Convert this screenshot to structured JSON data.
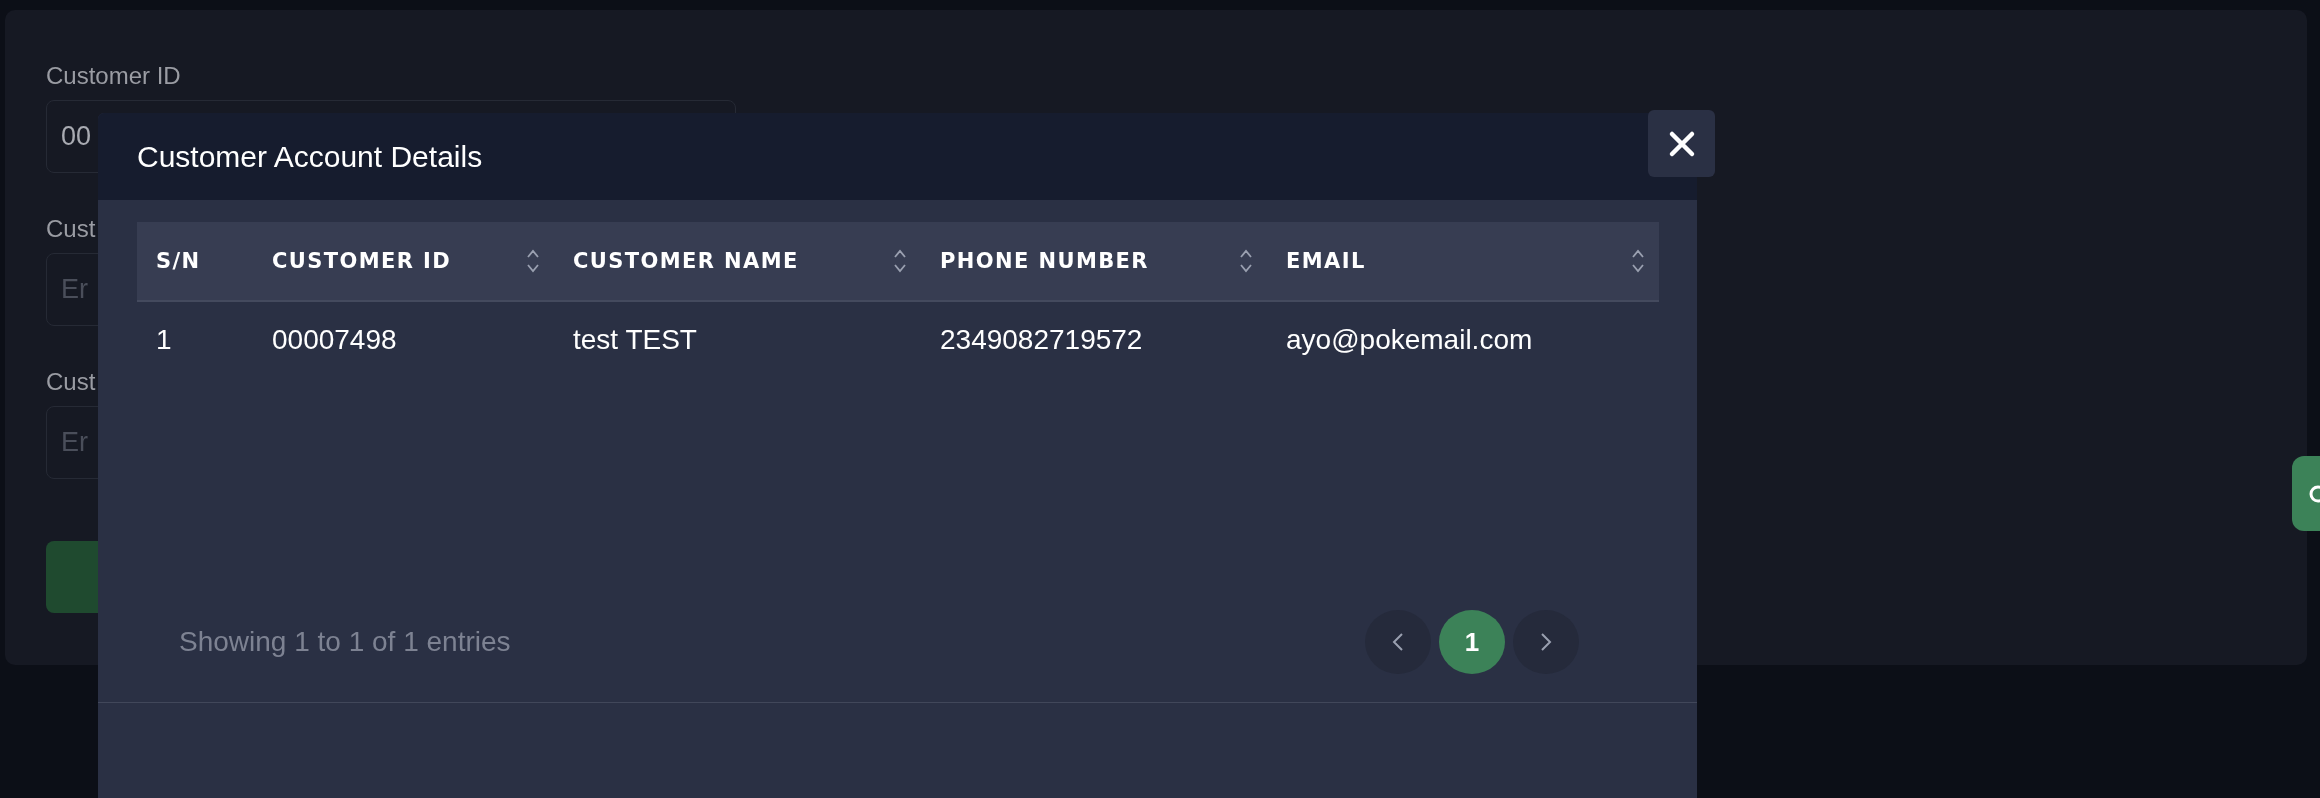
{
  "background_form": {
    "fields": [
      {
        "label": "Customer ID",
        "value": "00"
      },
      {
        "label": "Cust",
        "placeholder": "Er"
      },
      {
        "label": "Cust",
        "placeholder": "Er"
      }
    ]
  },
  "modal": {
    "title": "Customer Account Details",
    "table": {
      "columns": [
        {
          "label": "S/N",
          "sortable": false
        },
        {
          "label": "CUSTOMER ID",
          "sortable": true
        },
        {
          "label": "CUSTOMER NAME",
          "sortable": true
        },
        {
          "label": "PHONE NUMBER",
          "sortable": true
        },
        {
          "label": "EMAIL",
          "sortable": true
        }
      ],
      "rows": [
        [
          "1",
          "00007498",
          "test TEST",
          "2349082719572",
          "ayo@pokemail.com"
        ]
      ]
    },
    "summary": "Showing 1 to 1 of 1 entries",
    "pages": [
      {
        "label": "1",
        "selected": true
      }
    ]
  }
}
